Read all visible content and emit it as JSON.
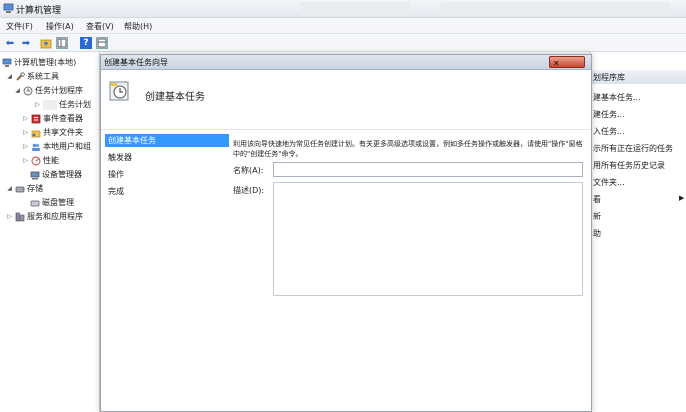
{
  "window": {
    "title": "计算机管理"
  },
  "menu": {
    "file": "文件(F)",
    "action": "操作(A)",
    "view": "查看(V)",
    "help": "帮助(H)"
  },
  "tree": {
    "root": "计算机管理(本地)",
    "system_tools": "系统工具",
    "task_scheduler": "任务计划程序",
    "task_library": "任务计划",
    "event_viewer": "事件查看器",
    "shared_folders": "共享文件夹",
    "local_users": "本地用户和组",
    "performance": "性能",
    "device_manager": "设备管理器",
    "storage": "存储",
    "disk_management": "磁盘管理",
    "services": "服务和应用程序"
  },
  "actions": {
    "header": "划程序库",
    "items": [
      "建基本任务...",
      "建任务...",
      "入任务...",
      "示所有正在运行的任务",
      "用所有任务历史记录",
      "文件夹...",
      "看",
      "新",
      "助"
    ]
  },
  "dialog": {
    "title": "创建基本任务向导",
    "heading": "创建基本任务",
    "steps": [
      "创建基本任务",
      "触发器",
      "操作",
      "完成"
    ],
    "description": "利用该向导快速地为常见任务创建计划。有关更多高级选项或设置，例如多任务操作或触发器，请使用\"操作\"窗格中的\"创建任务\"命令。",
    "name_label": "名称(A):",
    "desc_label": "描述(D):",
    "name_value": "",
    "desc_value": ""
  },
  "colors": {
    "selection": "#3399ff",
    "close": "#c8482f"
  }
}
